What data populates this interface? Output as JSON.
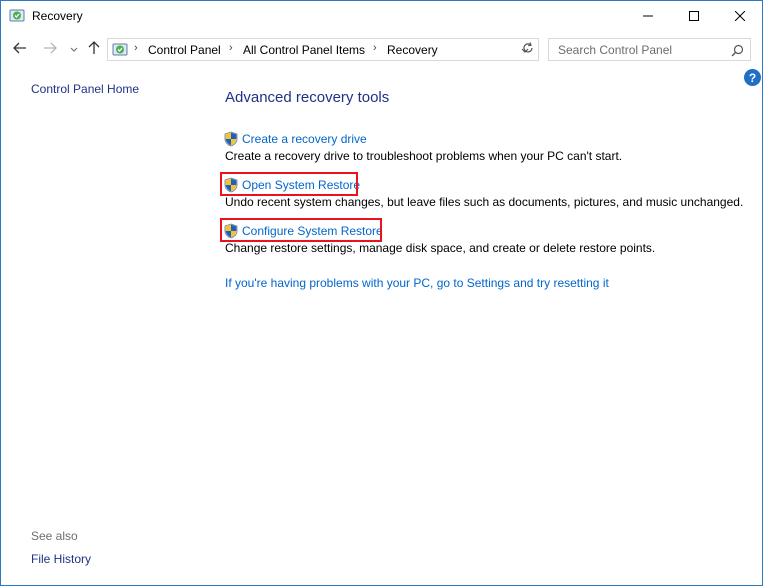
{
  "window": {
    "title": "Recovery",
    "controls": {
      "minimize": "minimize-icon",
      "maximize": "maximize-icon",
      "close": "close-icon"
    }
  },
  "nav": {
    "breadcrumb": [
      "Control Panel",
      "All Control Panel Items",
      "Recovery"
    ],
    "search_placeholder": "Search Control Panel"
  },
  "left_pane": {
    "home_link": "Control Panel Home",
    "see_also_label": "See also",
    "see_also_links": [
      "File History"
    ]
  },
  "main": {
    "title": "Advanced recovery tools",
    "tasks": [
      {
        "label": "Create a recovery drive",
        "description": "Create a recovery drive to troubleshoot problems when your PC can't start.",
        "highlighted": false
      },
      {
        "label": "Open System Restore",
        "description": "Undo recent system changes, but leave files such as documents, pictures, and music unchanged.",
        "highlighted": true
      },
      {
        "label": "Configure System Restore",
        "description": "Change restore settings, manage disk space, and create or delete restore points.",
        "highlighted": true
      }
    ],
    "reset_link": "If you're having problems with your PC, go to Settings and try resetting it"
  },
  "colors": {
    "link": "#0066cc",
    "heading": "#1e3287",
    "highlight_border": "#e8131c",
    "window_border": "#2b79c2"
  }
}
